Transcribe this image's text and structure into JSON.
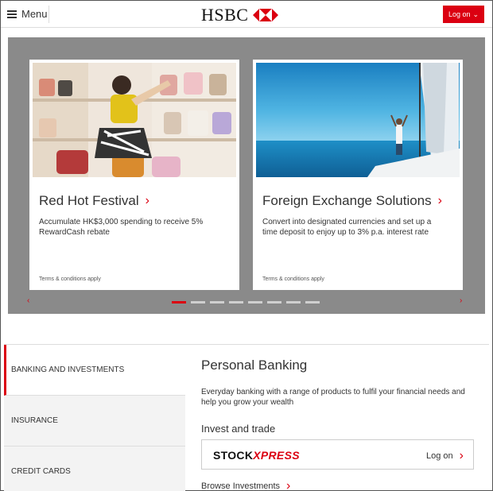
{
  "header": {
    "menu_label": "Menu",
    "brand": "HSBC",
    "logon_label": "Log on",
    "logon_chevron": "⌄"
  },
  "carousel": {
    "cards": [
      {
        "title": "Red Hot Festival",
        "description": "Accumulate HK$3,000 spending to receive 5% RewardCash rebate",
        "terms": "Terms & conditions apply"
      },
      {
        "title": "Foreign Exchange Solutions",
        "description": "Convert into designated currencies and set up a time deposit to enjoy up to 3% p.a. interest rate",
        "terms": "Terms & conditions apply"
      }
    ],
    "prev_arrow": "‹",
    "next_arrow": "›",
    "chevron": "›",
    "slide_count": 8,
    "active_slide": 1
  },
  "sidebar": {
    "items": [
      {
        "label": "BANKING AND INVESTMENTS"
      },
      {
        "label": "INSURANCE"
      },
      {
        "label": "CREDIT CARDS"
      }
    ]
  },
  "content": {
    "title": "Personal Banking",
    "description": "Everyday banking with a range of products to fulfil your financial needs and help you grow your wealth",
    "invest_title": "Invest and trade",
    "stock_logo_a": "STOCK",
    "stock_logo_b": "XPRESS",
    "stock_logon": "Log on",
    "browse": "Browse Investments",
    "chevron": "›"
  },
  "colors": {
    "brand_red": "#db0011",
    "carousel_bg": "#8a8a8a",
    "sidebar_bg": "#f3f3f3"
  }
}
